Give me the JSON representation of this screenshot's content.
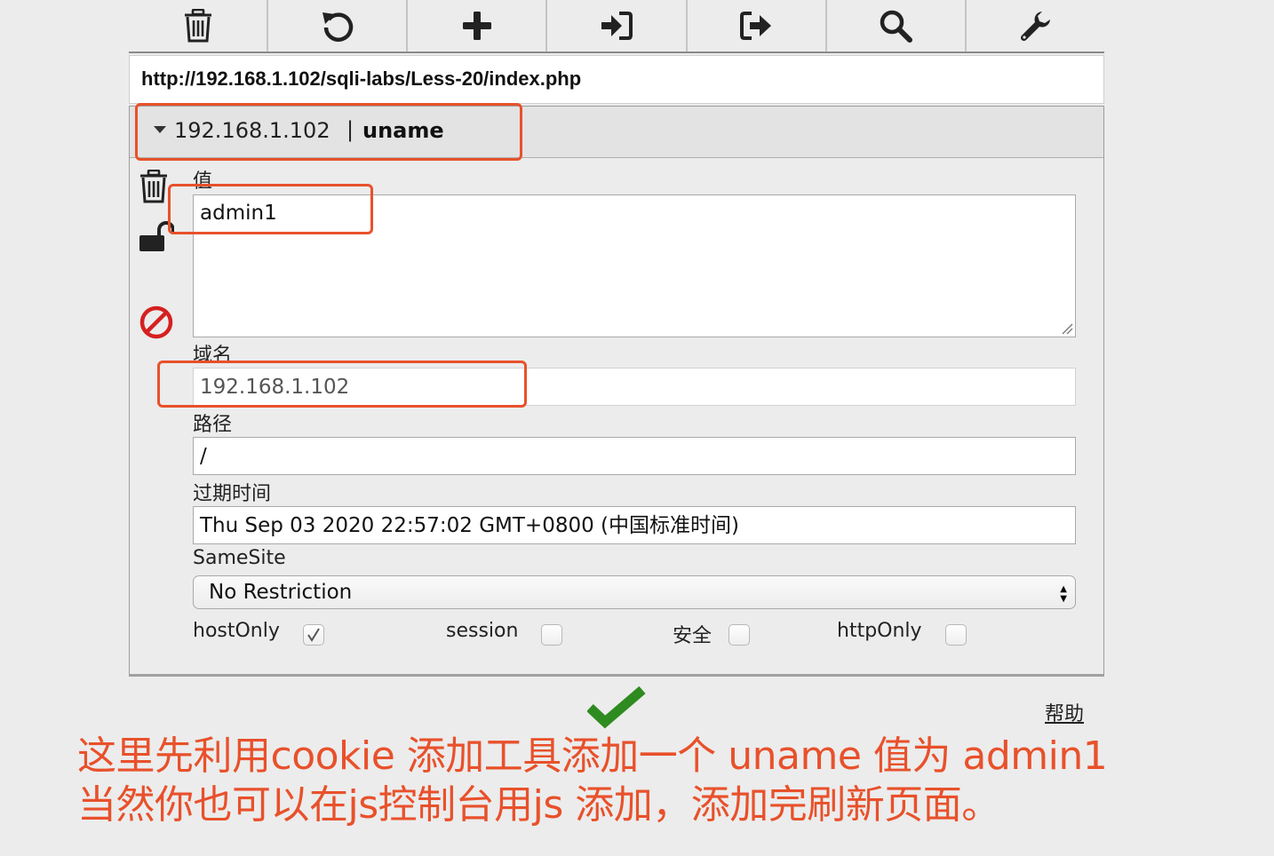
{
  "toolbar": {
    "icons": [
      "trash-icon",
      "refresh-icon",
      "plus-icon",
      "import-icon",
      "export-icon",
      "search-icon",
      "wrench-icon"
    ]
  },
  "url": "http://192.168.1.102/sqli-labs/Less-20/index.php",
  "cookie": {
    "host": "192.168.1.102",
    "separator": "|",
    "name": "uname"
  },
  "form": {
    "value_label": "值",
    "value": "admin1",
    "domain_label": "域名",
    "domain": "192.168.1.102",
    "path_label": "路径",
    "path": "/",
    "expires_label": "过期时间",
    "expires": "Thu Sep 03 2020 22:57:02 GMT+0800 (中国标准时间)",
    "samesite_label": "SameSite",
    "samesite": "No Restriction",
    "checkboxes": [
      {
        "label": "hostOnly",
        "checked": true
      },
      {
        "label": "session",
        "checked": false
      },
      {
        "label": "安全",
        "checked": false
      },
      {
        "label": "httpOnly",
        "checked": false
      }
    ]
  },
  "help_link": "帮助",
  "annotation": {
    "line1": "这里先利用cookie 添加工具添加一个 uname 值为 admin1",
    "line2": "当然你也可以在js控制台用js 添加，添加完刷新页面。"
  },
  "colors": {
    "annotation": "#e8512b",
    "check_mark": "#2e8b1f",
    "block_icon": "#d62020"
  }
}
